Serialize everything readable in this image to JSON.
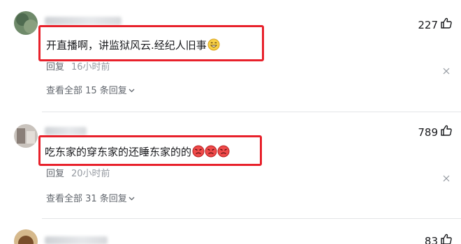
{
  "comments": [
    {
      "text": "开直播啊，讲监狱风云.经纪人旧事",
      "emoji": "smile-emoji",
      "reply_label": "回复",
      "time": "16小时前",
      "replies_link": "查看全部 15 条回复",
      "likes": "227"
    },
    {
      "text": "吃东家的穿东家的还睡东家的的",
      "emoji": "angry-emoji",
      "reply_label": "回复",
      "time": "20小时前",
      "replies_link": "查看全部 31 条回复",
      "likes": "789"
    },
    {
      "likes": "83"
    }
  ],
  "colors": {
    "highlight_border": "#e8212b",
    "meta_text": "#61666d",
    "time_text": "#9499a0",
    "divider": "#e3e5e7"
  },
  "icons": [
    "thumb-up-icon",
    "close-icon",
    "chevron-down-icon",
    "smile-emoji",
    "angry-emoji"
  ]
}
